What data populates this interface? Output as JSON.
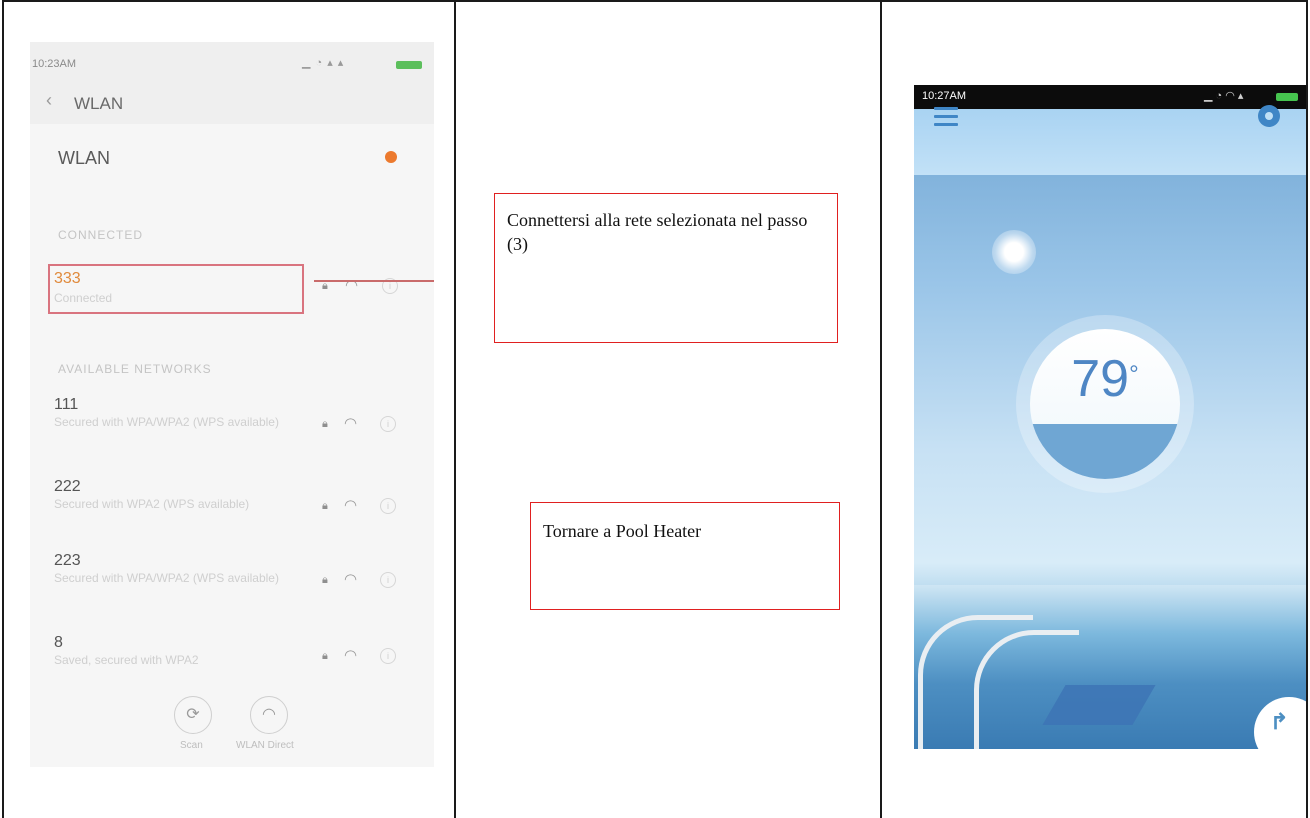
{
  "phone_wlan": {
    "status_time": "10:23AM",
    "page_title": "WLAN",
    "wlan_toggle_label": "WLAN",
    "connected_header": "CONNECTED",
    "connected_network": {
      "name": "333",
      "status": "Connected"
    },
    "available_header": "AVAILABLE NETWORKS",
    "networks": [
      {
        "name": "111",
        "sub": "Secured with WPA/WPA2 (WPS available)"
      },
      {
        "name": "222",
        "sub": "Secured with WPA2 (WPS available)"
      },
      {
        "name": "223",
        "sub": "Secured with WPA/WPA2 (WPS available)"
      },
      {
        "name": "8",
        "sub": "Saved, secured with WPA2"
      }
    ],
    "bottom_buttons": [
      "Scan",
      "WLAN Direct"
    ]
  },
  "callouts": {
    "connect": "Connettersi alla rete selezionata nel passo (3)",
    "return": "Tornare a Pool Heater"
  },
  "phone_app": {
    "status_time": "10:27AM",
    "temperature": "79",
    "degree_symbol": "°"
  },
  "colors": {
    "highlight": "#d9747f",
    "callout_border": "#e02020",
    "toggle_on": "#ec7a2e",
    "gauge_blue": "#4e86c4"
  }
}
